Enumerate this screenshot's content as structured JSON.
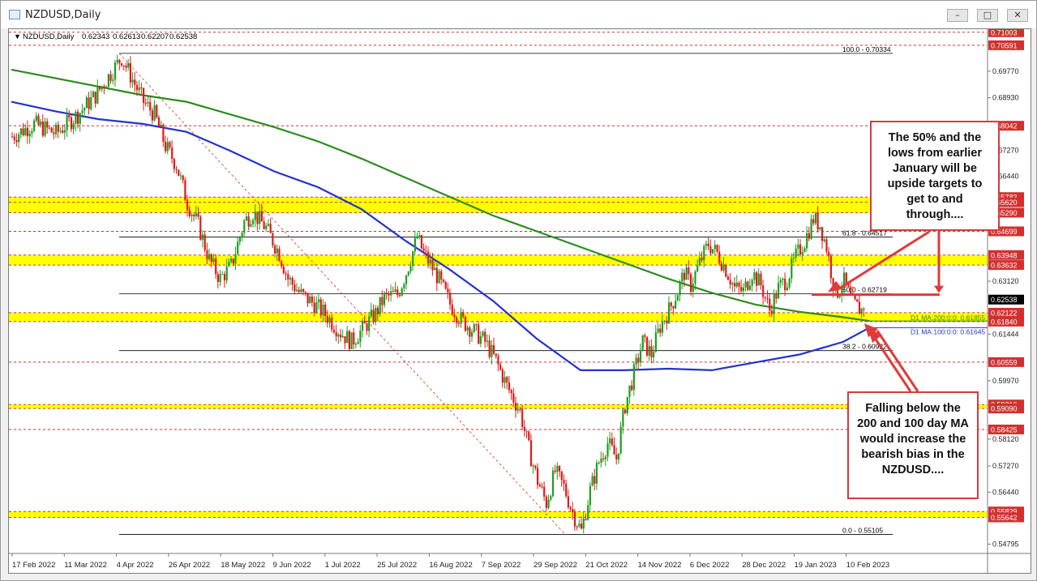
{
  "window": {
    "title": "NZDUSD,Daily"
  },
  "chart_data": {
    "type": "candlestick",
    "symbol_info": {
      "name": "NZDUSD,Daily",
      "open": "0.62343",
      "high": "0.62613",
      "low": "0.62207",
      "close": "0.62538"
    },
    "x_tick_labels": [
      "17 Feb 2022",
      "11 Mar 2022",
      "4 Apr 2022",
      "26 Apr 2022",
      "18 May 2022",
      "9 Jun 2022",
      "1 Jul 2022",
      "25 Jul 2022",
      "16 Aug 2022",
      "7 Sep 2022",
      "29 Sep 2022",
      "21 Oct 2022",
      "14 Nov 2022",
      "6 Dec 2022",
      "28 Dec 2022",
      "19 Jan 2023",
      "10 Feb 2023"
    ],
    "y_tick_labels": [
      "0.69770",
      "0.68930",
      "0.67270",
      "0.66440",
      "0.63120",
      "0.61444",
      "0.59970",
      "0.58120",
      "0.57270",
      "0.56440",
      "0.54795"
    ],
    "ylim": [
      0.545,
      0.711
    ],
    "price_levels": [
      {
        "label": "0.71003",
        "value": 0.71003
      },
      {
        "label": "0.70591",
        "value": 0.70591
      },
      {
        "label": "0.68042",
        "value": 0.68042
      },
      {
        "label": "0.65783",
        "value": 0.65783
      },
      {
        "label": "0.65620",
        "value": 0.6562
      },
      {
        "label": "0.65290",
        "value": 0.6529
      },
      {
        "label": "0.64699",
        "value": 0.64699
      },
      {
        "label": "0.63948",
        "value": 0.63948
      },
      {
        "label": "0.63632",
        "value": 0.63632
      },
      {
        "label": "0.62538",
        "value": 0.62538,
        "current": true
      },
      {
        "label": "0.62122",
        "value": 0.62122
      },
      {
        "label": "0.61840",
        "value": 0.6184
      },
      {
        "label": "0.60559",
        "value": 0.60559
      },
      {
        "label": "0.59216",
        "value": 0.59216
      },
      {
        "label": "0.59090",
        "value": 0.5909
      },
      {
        "label": "0.58425",
        "value": 0.58425
      },
      {
        "label": "0.55829",
        "value": 0.55829
      },
      {
        "label": "0.55642",
        "value": 0.55642
      }
    ],
    "zones": [
      {
        "low": 0.6529,
        "high": 0.65783
      },
      {
        "low": 0.63632,
        "high": 0.63948
      },
      {
        "low": 0.6184,
        "high": 0.62122
      },
      {
        "low": 0.5909,
        "high": 0.59216
      },
      {
        "low": 0.55642,
        "high": 0.55829
      }
    ],
    "fib_levels": [
      {
        "label": "100.0 - 0.70334",
        "value": 0.70334
      },
      {
        "label": "61.8 - 0.64517",
        "value": 0.64517
      },
      {
        "label": "50.0 - 0.62719",
        "value": 0.62719
      },
      {
        "label": "38.2 - 0.60922",
        "value": 0.60922
      },
      {
        "label": "0.0 - 0.55105",
        "value": 0.55105
      }
    ],
    "moving_averages": [
      {
        "label": "D1 MA:200:0:0: 0.61855",
        "period": 200,
        "color": "#2e8b1e",
        "points": [
          [
            0,
            0.6982
          ],
          [
            20,
            0.6955
          ],
          [
            40,
            0.6928
          ],
          [
            60,
            0.6901
          ],
          [
            80,
            0.688
          ],
          [
            100,
            0.684
          ],
          [
            120,
            0.68
          ],
          [
            140,
            0.6755
          ],
          [
            160,
            0.67
          ],
          [
            180,
            0.664
          ],
          [
            200,
            0.658
          ],
          [
            220,
            0.652
          ],
          [
            240,
            0.647
          ],
          [
            260,
            0.642
          ],
          [
            280,
            0.637
          ],
          [
            300,
            0.632
          ],
          [
            320,
            0.6275
          ],
          [
            340,
            0.6238
          ],
          [
            360,
            0.6215
          ],
          [
            380,
            0.6198
          ],
          [
            392,
            0.6186
          ]
        ]
      },
      {
        "label": "D1 MA:100:0:0: 0.61645",
        "period": 100,
        "color": "#2233cc",
        "points": [
          [
            0,
            0.688
          ],
          [
            20,
            0.685
          ],
          [
            40,
            0.6825
          ],
          [
            60,
            0.681
          ],
          [
            80,
            0.6785
          ],
          [
            100,
            0.6725
          ],
          [
            120,
            0.666
          ],
          [
            140,
            0.661
          ],
          [
            160,
            0.654
          ],
          [
            180,
            0.644
          ],
          [
            200,
            0.635
          ],
          [
            220,
            0.625
          ],
          [
            240,
            0.613
          ],
          [
            260,
            0.603
          ],
          [
            280,
            0.603
          ],
          [
            300,
            0.6035
          ],
          [
            320,
            0.603
          ],
          [
            340,
            0.6055
          ],
          [
            360,
            0.608
          ],
          [
            380,
            0.612
          ],
          [
            392,
            0.6165
          ]
        ]
      }
    ],
    "price_path": [
      [
        0,
        0.677
      ],
      [
        10,
        0.681
      ],
      [
        20,
        0.678
      ],
      [
        30,
        0.684
      ],
      [
        38,
        0.69
      ],
      [
        45,
        0.697
      ],
      [
        50,
        0.702
      ],
      [
        55,
        0.695
      ],
      [
        60,
        0.688
      ],
      [
        65,
        0.684
      ],
      [
        70,
        0.674
      ],
      [
        75,
        0.668
      ],
      [
        80,
        0.656
      ],
      [
        85,
        0.649
      ],
      [
        90,
        0.638
      ],
      [
        95,
        0.632
      ],
      [
        100,
        0.636
      ],
      [
        106,
        0.65
      ],
      [
        110,
        0.653
      ],
      [
        116,
        0.648
      ],
      [
        122,
        0.64
      ],
      [
        126,
        0.632
      ],
      [
        132,
        0.627
      ],
      [
        138,
        0.624
      ],
      [
        144,
        0.62
      ],
      [
        150,
        0.615
      ],
      [
        155,
        0.612
      ],
      [
        160,
        0.616
      ],
      [
        166,
        0.621
      ],
      [
        170,
        0.626
      ],
      [
        176,
        0.627
      ],
      [
        180,
        0.634
      ],
      [
        185,
        0.645
      ],
      [
        188,
        0.64
      ],
      [
        194,
        0.633
      ],
      [
        200,
        0.624
      ],
      [
        205,
        0.619
      ],
      [
        210,
        0.616
      ],
      [
        216,
        0.612
      ],
      [
        221,
        0.606
      ],
      [
        226,
        0.598
      ],
      [
        232,
        0.59
      ],
      [
        236,
        0.578
      ],
      [
        240,
        0.568
      ],
      [
        244,
        0.561
      ],
      [
        248,
        0.571
      ],
      [
        252,
        0.566
      ],
      [
        256,
        0.558
      ],
      [
        260,
        0.552
      ],
      [
        264,
        0.565
      ],
      [
        268,
        0.574
      ],
      [
        272,
        0.58
      ],
      [
        276,
        0.575
      ],
      [
        280,
        0.592
      ],
      [
        284,
        0.602
      ],
      [
        288,
        0.612
      ],
      [
        292,
        0.608
      ],
      [
        296,
        0.617
      ],
      [
        300,
        0.622
      ],
      [
        304,
        0.628
      ],
      [
        307,
        0.634
      ],
      [
        310,
        0.63
      ],
      [
        314,
        0.637
      ],
      [
        318,
        0.643
      ],
      [
        322,
        0.64
      ],
      [
        326,
        0.635
      ],
      [
        330,
        0.629
      ],
      [
        334,
        0.628
      ],
      [
        338,
        0.634
      ],
      [
        342,
        0.63
      ],
      [
        346,
        0.622
      ],
      [
        350,
        0.629
      ],
      [
        354,
        0.632
      ],
      [
        358,
        0.639
      ],
      [
        362,
        0.644
      ],
      [
        366,
        0.651
      ],
      [
        369,
        0.649
      ],
      [
        372,
        0.642
      ],
      [
        376,
        0.627
      ],
      [
        380,
        0.631
      ],
      [
        384,
        0.624
      ],
      [
        388,
        0.622
      ],
      [
        390,
        0.6254
      ]
    ],
    "annotations": [
      {
        "lines": [
          "The 50% and the",
          "lows from earlier",
          "January will be",
          "upside targets to",
          "get to and",
          "through...."
        ]
      },
      {
        "lines": [
          "Falling below the",
          "200 and 100 day MA",
          "would increase the",
          "bearish bias in the",
          "NZDUSD...."
        ]
      }
    ]
  }
}
